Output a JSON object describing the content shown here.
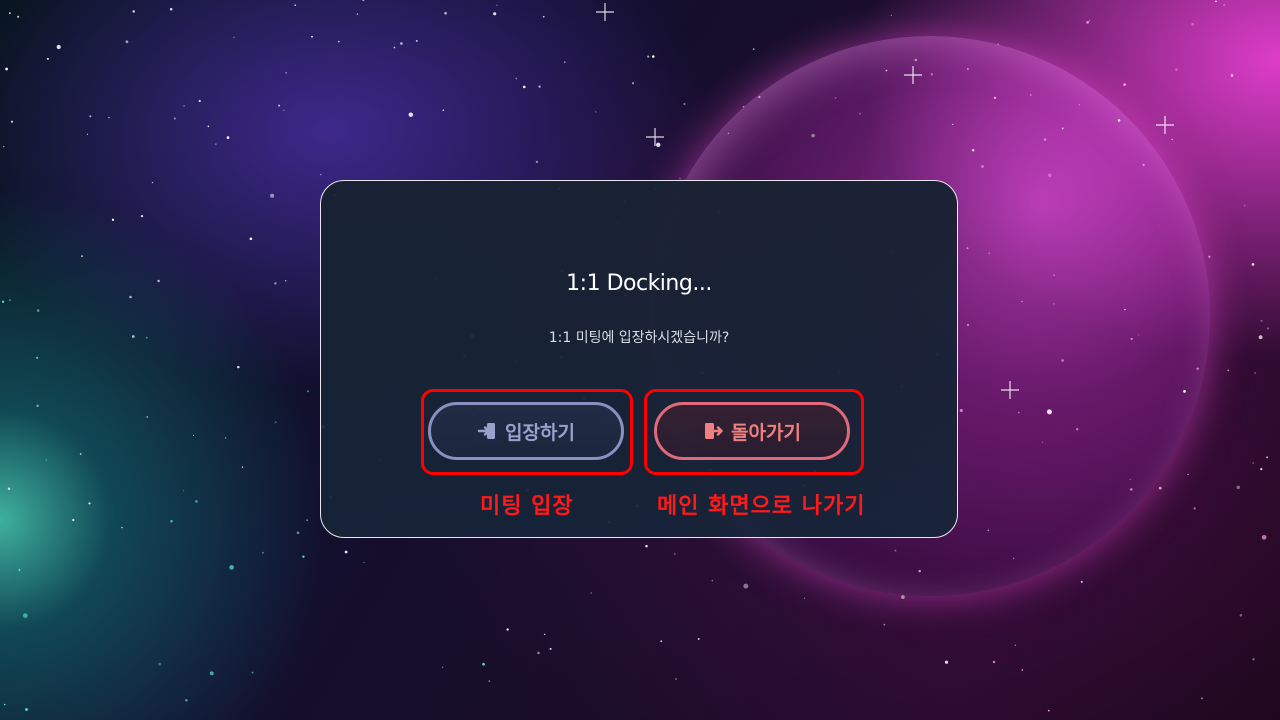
{
  "dialog": {
    "title": "1:1 Docking...",
    "message": "1:1 미팅에 입장하시겠습니까?"
  },
  "buttons": {
    "enter_label": "입장하기",
    "back_label": "돌아가기"
  },
  "annotations": {
    "enter_note": "미팅 입장",
    "back_note": "메인 화면으로 나가기"
  },
  "icons": {
    "enter": "sign-in-icon",
    "back": "door-exit-icon"
  },
  "colors": {
    "annotation": "#ff0000",
    "enter_border": "#8a8fc0",
    "back_border": "#e06a7a"
  }
}
